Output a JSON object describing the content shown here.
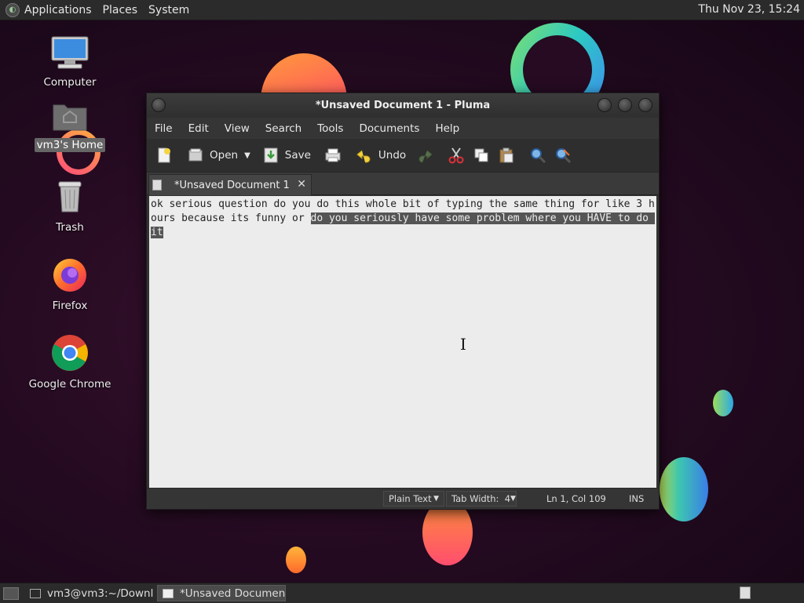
{
  "top_panel": {
    "menus": [
      "Applications",
      "Places",
      "System"
    ],
    "clock": "Thu Nov 23, 15:24"
  },
  "desktop_icons": {
    "computer": "Computer",
    "home": "vm3's Home",
    "trash": "Trash",
    "firefox": "Firefox",
    "chrome": "Google Chrome"
  },
  "window": {
    "title": "*Unsaved Document 1 - Pluma",
    "menus": [
      "File",
      "Edit",
      "View",
      "Search",
      "Tools",
      "Documents",
      "Help"
    ],
    "toolbar": {
      "new_icon": "new-document-icon",
      "open_label": "Open",
      "save_label": "Save",
      "print_icon": "print-icon",
      "undo_label": "Undo",
      "redo_icon": "redo-icon",
      "cut_icon": "cut-icon",
      "copy_icon": "copy-icon",
      "paste_icon": "paste-icon",
      "find_icon": "find-icon",
      "replace_icon": "replace-icon"
    },
    "tab_label": "*Unsaved Document 1",
    "editor": {
      "text_plain": "ok serious question do you do this whole bit of typing the same thing for like 3 hours because its funny or ",
      "text_selected": "do you seriously have some problem where you HAVE to do it"
    },
    "statusbar": {
      "language": "Plain Text",
      "tab_width": "Tab Width:  4",
      "position": "Ln 1, Col 109",
      "mode": "INS"
    }
  },
  "bottom_panel": {
    "tasks": [
      "vm3@vm3:~/Downl...",
      "*Unsaved Documen..."
    ]
  },
  "colors": {
    "panel": "#2b2b2b",
    "editor_bg": "#ececec",
    "selection": "#555555"
  }
}
